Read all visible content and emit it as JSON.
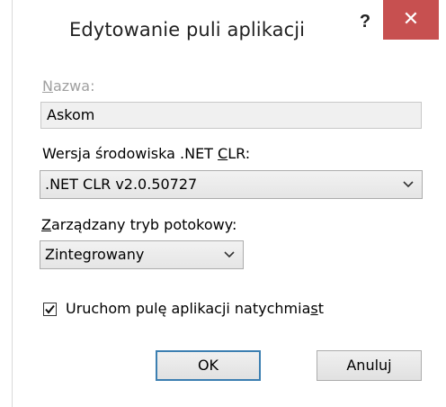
{
  "dialog": {
    "title": "Edytowanie puli aplikacji",
    "help_label": "?",
    "close_icon": "close-icon"
  },
  "name_field": {
    "label_u": "N",
    "label_rest": "azwa:",
    "value": "Askom"
  },
  "clr_field": {
    "label_pre": "Wersja środowiska .NET ",
    "label_u": "C",
    "label_post": "LR:",
    "value": ".NET CLR v2.0.50727"
  },
  "pipeline_field": {
    "label_u": "Z",
    "label_rest": "arządzany tryb potokowy:",
    "value": "Zintegrowany"
  },
  "start_checkbox": {
    "checked": true,
    "label_pre": "Uruchom pulę aplikacji natychmia",
    "label_u": "s",
    "label_post": "t"
  },
  "buttons": {
    "ok_label": "OK",
    "cancel_label": "Anuluj"
  },
  "colors": {
    "close_bg": "#c75050",
    "default_button_border": "#3c7fb1"
  }
}
